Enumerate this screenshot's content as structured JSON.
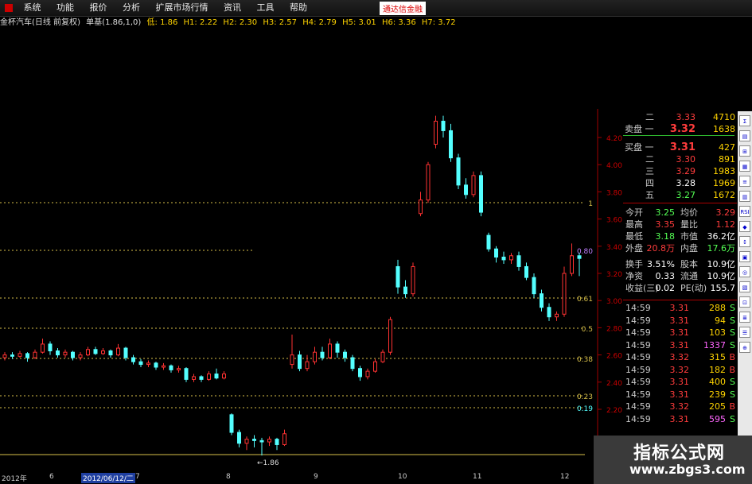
{
  "menu": {
    "items": [
      "系统",
      "功能",
      "报价",
      "分析",
      "扩展市场行情",
      "资讯",
      "工具",
      "帮助"
    ],
    "brand": "通达信金融"
  },
  "info": {
    "stock": "金杯汽车(日线 前复权)",
    "indicator": "单基(1.86,1,0)",
    "low": "低: 1.86",
    "h": [
      "H1: 2.22",
      "H2: 2.30",
      "H3: 2.57",
      "H4: 2.79",
      "H5: 3.01",
      "H6: 3.36",
      "H7: 3.72"
    ]
  },
  "y_axis_labels": [
    "4.20",
    "4.00",
    "3.80",
    "3.60",
    "3.40",
    "3.20",
    "3.00",
    "2.80",
    "2.60",
    "2.40",
    "2.20"
  ],
  "fib_labels": [
    "1",
    "0.80",
    "0.61",
    "0.5",
    "0.38",
    "0.23",
    "0.19"
  ],
  "chart_data": {
    "type": "candlestick",
    "low_label": "1.86",
    "series": [
      {
        "o": 2.58,
        "c": 2.6,
        "h": 2.62,
        "l": 2.56
      },
      {
        "o": 2.6,
        "c": 2.59,
        "h": 2.62,
        "l": 2.57
      },
      {
        "o": 2.59,
        "c": 2.61,
        "h": 2.63,
        "l": 2.58
      },
      {
        "o": 2.61,
        "c": 2.58,
        "h": 2.62,
        "l": 2.55
      },
      {
        "o": 2.58,
        "c": 2.62,
        "h": 2.64,
        "l": 2.57
      },
      {
        "o": 2.62,
        "c": 2.68,
        "h": 2.72,
        "l": 2.61
      },
      {
        "o": 2.68,
        "c": 2.63,
        "h": 2.7,
        "l": 2.6
      },
      {
        "o": 2.63,
        "c": 2.6,
        "h": 2.65,
        "l": 2.58
      },
      {
        "o": 2.6,
        "c": 2.62,
        "h": 2.64,
        "l": 2.58
      },
      {
        "o": 2.62,
        "c": 2.58,
        "h": 2.63,
        "l": 2.56
      },
      {
        "o": 2.58,
        "c": 2.6,
        "h": 2.62,
        "l": 2.56
      },
      {
        "o": 2.6,
        "c": 2.64,
        "h": 2.66,
        "l": 2.59
      },
      {
        "o": 2.64,
        "c": 2.61,
        "h": 2.66,
        "l": 2.6
      },
      {
        "o": 2.61,
        "c": 2.63,
        "h": 2.65,
        "l": 2.6
      },
      {
        "o": 2.63,
        "c": 2.6,
        "h": 2.64,
        "l": 2.58
      },
      {
        "o": 2.6,
        "c": 2.65,
        "h": 2.68,
        "l": 2.59
      },
      {
        "o": 2.65,
        "c": 2.58,
        "h": 2.66,
        "l": 2.56
      },
      {
        "o": 2.58,
        "c": 2.55,
        "h": 2.6,
        "l": 2.53
      },
      {
        "o": 2.55,
        "c": 2.53,
        "h": 2.57,
        "l": 2.51
      },
      {
        "o": 2.53,
        "c": 2.54,
        "h": 2.56,
        "l": 2.51
      },
      {
        "o": 2.54,
        "c": 2.51,
        "h": 2.55,
        "l": 2.49
      },
      {
        "o": 2.51,
        "c": 2.52,
        "h": 2.54,
        "l": 2.49
      },
      {
        "o": 2.52,
        "c": 2.49,
        "h": 2.53,
        "l": 2.47
      },
      {
        "o": 2.49,
        "c": 2.5,
        "h": 2.52,
        "l": 2.47
      },
      {
        "o": 2.5,
        "c": 2.42,
        "h": 2.51,
        "l": 2.4
      },
      {
        "o": 2.42,
        "c": 2.44,
        "h": 2.46,
        "l": 2.4
      },
      {
        "o": 2.44,
        "c": 2.42,
        "h": 2.45,
        "l": 2.4
      },
      {
        "o": 2.42,
        "c": 2.46,
        "h": 2.48,
        "l": 2.41
      },
      {
        "o": 2.46,
        "c": 2.43,
        "h": 2.5,
        "l": 2.42
      },
      {
        "o": 2.43,
        "c": 2.46,
        "h": 2.48,
        "l": 2.42
      },
      {
        "o": 2.16,
        "c": 2.03,
        "h": 2.17,
        "l": 2.01
      },
      {
        "o": 2.03,
        "c": 1.95,
        "h": 2.05,
        "l": 1.92
      },
      {
        "o": 1.95,
        "c": 1.98,
        "h": 2.0,
        "l": 1.9
      },
      {
        "o": 1.98,
        "c": 1.97,
        "h": 2.01,
        "l": 1.92
      },
      {
        "o": 1.97,
        "c": 1.96,
        "h": 1.99,
        "l": 1.86
      },
      {
        "o": 1.96,
        "c": 1.98,
        "h": 2.0,
        "l": 1.93
      },
      {
        "o": 1.98,
        "c": 1.94,
        "h": 1.99,
        "l": 1.9
      },
      {
        "o": 1.94,
        "c": 2.02,
        "h": 2.05,
        "l": 1.93
      },
      {
        "o": 2.53,
        "c": 2.6,
        "h": 2.75,
        "l": 2.5
      },
      {
        "o": 2.6,
        "c": 2.5,
        "h": 2.63,
        "l": 2.48
      },
      {
        "o": 2.5,
        "c": 2.55,
        "h": 2.6,
        "l": 2.48
      },
      {
        "o": 2.55,
        "c": 2.62,
        "h": 2.66,
        "l": 2.53
      },
      {
        "o": 2.62,
        "c": 2.58,
        "h": 2.66,
        "l": 2.56
      },
      {
        "o": 2.58,
        "c": 2.68,
        "h": 2.72,
        "l": 2.57
      },
      {
        "o": 2.68,
        "c": 2.62,
        "h": 2.7,
        "l": 2.58
      },
      {
        "o": 2.62,
        "c": 2.58,
        "h": 2.64,
        "l": 2.55
      },
      {
        "o": 2.58,
        "c": 2.5,
        "h": 2.6,
        "l": 2.48
      },
      {
        "o": 2.5,
        "c": 2.44,
        "h": 2.52,
        "l": 2.41
      },
      {
        "o": 2.44,
        "c": 2.48,
        "h": 2.5,
        "l": 2.42
      },
      {
        "o": 2.48,
        "c": 2.55,
        "h": 2.57,
        "l": 2.47
      },
      {
        "o": 2.55,
        "c": 2.62,
        "h": 2.64,
        "l": 2.54
      },
      {
        "o": 2.62,
        "c": 2.86,
        "h": 2.88,
        "l": 2.6
      },
      {
        "o": 3.25,
        "c": 3.1,
        "h": 3.3,
        "l": 3.05
      },
      {
        "o": 3.1,
        "c": 3.05,
        "h": 3.15,
        "l": 3.02
      },
      {
        "o": 3.05,
        "c": 3.25,
        "h": 3.28,
        "l": 3.03
      },
      {
        "o": 3.64,
        "c": 3.74,
        "h": 3.8,
        "l": 3.62
      },
      {
        "o": 3.74,
        "c": 4.0,
        "h": 4.02,
        "l": 3.72
      },
      {
        "o": 4.15,
        "c": 4.32,
        "h": 4.36,
        "l": 4.12
      },
      {
        "o": 4.32,
        "c": 4.25,
        "h": 4.36,
        "l": 4.2
      },
      {
        "o": 4.25,
        "c": 4.05,
        "h": 4.3,
        "l": 4.02
      },
      {
        "o": 4.05,
        "c": 3.85,
        "h": 4.08,
        "l": 3.82
      },
      {
        "o": 3.85,
        "c": 3.78,
        "h": 3.9,
        "l": 3.75
      },
      {
        "o": 3.78,
        "c": 3.92,
        "h": 3.95,
        "l": 3.76
      },
      {
        "o": 3.92,
        "c": 3.65,
        "h": 3.95,
        "l": 3.62
      },
      {
        "o": 3.48,
        "c": 3.38,
        "h": 3.5,
        "l": 3.36
      },
      {
        "o": 3.38,
        "c": 3.32,
        "h": 3.4,
        "l": 3.28
      },
      {
        "o": 3.32,
        "c": 3.3,
        "h": 3.36,
        "l": 3.27
      },
      {
        "o": 3.3,
        "c": 3.33,
        "h": 3.35,
        "l": 3.27
      },
      {
        "o": 3.33,
        "c": 3.25,
        "h": 3.36,
        "l": 3.22
      },
      {
        "o": 3.25,
        "c": 3.17,
        "h": 3.28,
        "l": 3.15
      },
      {
        "o": 3.17,
        "c": 3.05,
        "h": 3.2,
        "l": 3.02
      },
      {
        "o": 3.05,
        "c": 2.95,
        "h": 3.08,
        "l": 2.92
      },
      {
        "o": 2.95,
        "c": 2.88,
        "h": 2.98,
        "l": 2.85
      },
      {
        "o": 2.88,
        "c": 2.9,
        "h": 2.92,
        "l": 2.85
      },
      {
        "o": 2.9,
        "c": 3.2,
        "h": 3.25,
        "l": 2.88
      },
      {
        "o": 3.2,
        "c": 3.33,
        "h": 3.42,
        "l": 3.18
      },
      {
        "o": 3.33,
        "c": 3.31,
        "h": 3.35,
        "l": 3.18
      }
    ],
    "colors": {
      "up": "#ff3232",
      "down": "#54ffff",
      "fib": "#d8c04a",
      "axis": "#a00000"
    }
  },
  "quote": {
    "sell2": {
      "label": "二",
      "price": "3.33",
      "vol": "4710"
    },
    "sell1": {
      "label": "卖盘 一",
      "price": "3.32",
      "vol": "1638"
    },
    "buy1": {
      "label": "买盘 一",
      "price": "3.31",
      "vol": "427"
    },
    "buy2": {
      "label": "二",
      "price": "3.30",
      "vol": "891"
    },
    "buy3": {
      "label": "三",
      "price": "3.29",
      "vol": "1983"
    },
    "buy4": {
      "label": "四",
      "price": "3.28",
      "vol": "1969"
    },
    "buy5": {
      "label": "五",
      "price": "3.27",
      "vol": "1672"
    },
    "stats": [
      {
        "l1": "今开",
        "v1": "3.25",
        "l2": "均价",
        "v2": "3.29"
      },
      {
        "l1": "最高",
        "v1": "3.35",
        "l2": "量比",
        "v2": "1.12"
      },
      {
        "l1": "最低",
        "v1": "3.18",
        "l2": "市值",
        "v2": "36.2亿"
      },
      {
        "l1": "外盘",
        "v1": "20.8万",
        "l2": "内盘",
        "v2": "17.6万"
      },
      {
        "l1": "换手",
        "v1": "3.51%",
        "l2": "股本",
        "v2": "10.9亿"
      },
      {
        "l1": "净资",
        "v1": "0.33",
        "l2": "流通",
        "v2": "10.9亿"
      },
      {
        "l1": "收益(三)",
        "v1": "0.02",
        "l2": "PE(动)",
        "v2": "155.7"
      }
    ],
    "ticks": [
      {
        "t": "14:59",
        "p": "3.31",
        "v": "288",
        "s": "S"
      },
      {
        "t": "14:59",
        "p": "3.31",
        "v": "94",
        "s": "S"
      },
      {
        "t": "14:59",
        "p": "3.31",
        "v": "103",
        "s": "S"
      },
      {
        "t": "14:59",
        "p": "3.31",
        "v": "1337",
        "s": "S"
      },
      {
        "t": "14:59",
        "p": "3.32",
        "v": "315",
        "s": "B"
      },
      {
        "t": "14:59",
        "p": "3.32",
        "v": "182",
        "s": "B"
      },
      {
        "t": "14:59",
        "p": "3.31",
        "v": "400",
        "s": "S"
      },
      {
        "t": "14:59",
        "p": "3.31",
        "v": "239",
        "s": "S"
      },
      {
        "t": "14:59",
        "p": "3.32",
        "v": "205",
        "s": "B"
      },
      {
        "t": "14:59",
        "p": "3.31",
        "v": "595",
        "s": "S"
      }
    ]
  },
  "toolbar_icons": [
    "Σ",
    "▤",
    "⊞",
    "▦",
    "≡",
    "▥",
    "RSI",
    "◆",
    "↕",
    "▣",
    "◎",
    "▧",
    "⊡",
    "≣",
    "☰",
    "⊕"
  ],
  "x_axis": [
    "2012年",
    "6",
    "2012/06/12/二",
    "7",
    "8",
    "9",
    "10",
    "11",
    "12"
  ],
  "watermark": {
    "title": "指标公式网",
    "url": "www.zbgs3.com"
  }
}
